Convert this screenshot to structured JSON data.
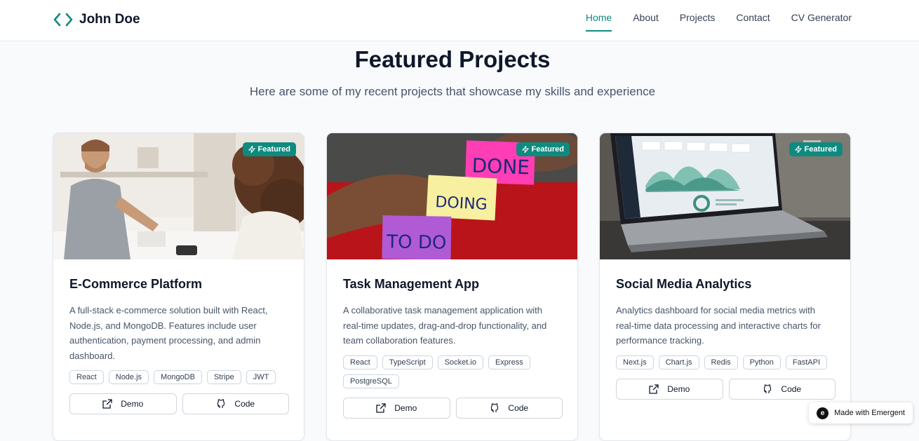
{
  "brand": {
    "name": "John Doe",
    "icon": "code-icon"
  },
  "nav": {
    "items": [
      {
        "label": "Home",
        "active": true
      },
      {
        "label": "About",
        "active": false
      },
      {
        "label": "Projects",
        "active": false
      },
      {
        "label": "Contact",
        "active": false
      },
      {
        "label": "CV Generator",
        "active": false
      }
    ]
  },
  "section": {
    "title": "Featured Projects",
    "subtitle": "Here are some of my recent projects that showcase my skills and experience"
  },
  "projects": [
    {
      "badge": "Featured",
      "title": "E-Commerce Platform",
      "description": "A full-stack e-commerce solution built with React, Node.js, and MongoDB. Features include user authentication, payment processing, and admin dashboard.",
      "tags": [
        "React",
        "Node.js",
        "MongoDB",
        "Stripe",
        "JWT"
      ],
      "demo_label": "Demo",
      "code_label": "Code"
    },
    {
      "badge": "Featured",
      "title": "Task Management App",
      "description": "A collaborative task management application with real-time updates, drag-and-drop functionality, and team collaboration features.",
      "tags": [
        "React",
        "TypeScript",
        "Socket.io",
        "Express",
        "PostgreSQL"
      ],
      "demo_label": "Demo",
      "code_label": "Code"
    },
    {
      "badge": "Featured",
      "title": "Social Media Analytics",
      "description": "Analytics dashboard for social media metrics with real-time data processing and interactive charts for performance tracking.",
      "tags": [
        "Next.js",
        "Chart.js",
        "Redis",
        "Python",
        "FastAPI"
      ],
      "demo_label": "Demo",
      "code_label": "Code"
    }
  ],
  "sticky_notes": [
    "DONE",
    "DOING",
    "TO DO"
  ],
  "footer_badge": {
    "label": "Made with Emergent",
    "logo": "e"
  },
  "colors": {
    "accent": "#0f8a7f",
    "text": "#0f172a",
    "muted": "#475569"
  }
}
